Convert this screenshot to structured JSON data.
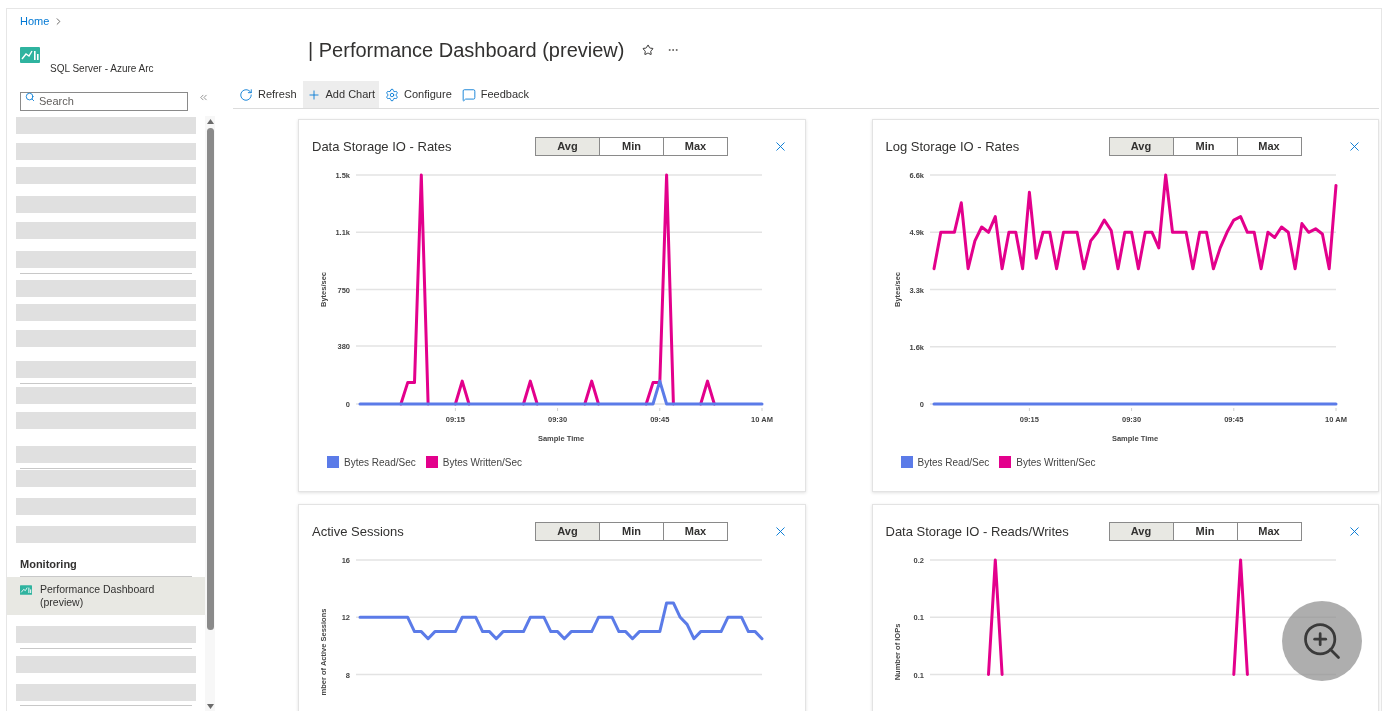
{
  "breadcrumb": [
    {
      "label": "Home"
    }
  ],
  "sidebar": {
    "resource_type": "SQL Server - Azure Arc",
    "search": {
      "placeholder": "Search"
    },
    "sections": [
      {
        "title": "Monitoring",
        "items": [
          {
            "label": "Performance Dashboard (preview)",
            "selected": true
          }
        ]
      }
    ]
  },
  "title": "| Performance Dashboard (preview)",
  "toolbar": [
    {
      "label": "Refresh",
      "kind": "refresh",
      "highlighted": false
    },
    {
      "label": "Add Chart",
      "kind": "add",
      "highlighted": true
    },
    {
      "label": "Configure",
      "kind": "configure",
      "highlighted": false
    },
    {
      "label": "Feedback",
      "kind": "feedback",
      "highlighted": false
    }
  ],
  "cards": [
    {
      "title": "Data Storage IO - Rates",
      "aggregations": [
        {
          "label": "Avg",
          "selected": true
        },
        {
          "label": "Min",
          "selected": false
        },
        {
          "label": "Max",
          "selected": false
        }
      ],
      "chart_data": {
        "type": "line",
        "xlabel": "Sample Time",
        "ylabel": "Bytes/sec",
        "ylim": [
          0,
          1500
        ],
        "grid": true,
        "categories": [
          null,
          null,
          null,
          null,
          null,
          null,
          null,
          null,
          null,
          null,
          null,
          null,
          null,
          null,
          "09:15",
          null,
          null,
          null,
          null,
          null,
          null,
          null,
          null,
          null,
          null,
          null,
          null,
          null,
          null,
          "09:30",
          null,
          null,
          null,
          null,
          null,
          null,
          null,
          null,
          null,
          null,
          null,
          null,
          null,
          null,
          "09:45",
          null,
          null,
          null,
          null,
          null,
          null,
          null,
          null,
          null,
          null,
          null,
          null,
          null,
          null,
          "10 AM"
        ],
        "yticks": [
          0,
          380,
          750,
          {
            "value": 1125,
            "label": "1.1k"
          },
          {
            "value": 1500,
            "label": "1.5k"
          }
        ],
        "series": [
          {
            "name": "Bytes Read/Sec",
            "color": "#5b7be8",
            "values": [
              0,
              0,
              0,
              0,
              0,
              0,
              0,
              0,
              0,
              0,
              0,
              0,
              0,
              0,
              0,
              0,
              0,
              0,
              0,
              0,
              0,
              0,
              0,
              0,
              0,
              0,
              0,
              0,
              0,
              0,
              0,
              0,
              0,
              0,
              0,
              0,
              0,
              0,
              0,
              0,
              0,
              0,
              0,
              0,
              150,
              0,
              0,
              0,
              0,
              0,
              0,
              0,
              0,
              0,
              0,
              0,
              0,
              0,
              0,
              0
            ]
          },
          {
            "name": "Bytes Written/Sec",
            "color": "#e3008c",
            "values": [
              null,
              null,
              null,
              null,
              null,
              null,
              0,
              140,
              140,
              1500,
              0,
              null,
              null,
              null,
              0,
              150,
              0,
              null,
              null,
              null,
              null,
              null,
              null,
              null,
              0,
              150,
              0,
              null,
              null,
              null,
              null,
              null,
              null,
              0,
              150,
              0,
              null,
              null,
              null,
              null,
              null,
              null,
              0,
              140,
              140,
              1500,
              0,
              null,
              null,
              null,
              0,
              150,
              0,
              null,
              null,
              null,
              null,
              null,
              null,
              null
            ]
          }
        ]
      }
    },
    {
      "title": "Log Storage IO - Rates",
      "aggregations": [
        {
          "label": "Avg",
          "selected": true
        },
        {
          "label": "Min",
          "selected": false
        },
        {
          "label": "Max",
          "selected": false
        }
      ],
      "chart_data": {
        "type": "line",
        "xlabel": "Sample Time",
        "ylabel": "Bytes/sec",
        "ylim": [
          0,
          6600
        ],
        "grid": true,
        "categories": [
          null,
          null,
          null,
          null,
          null,
          null,
          null,
          null,
          null,
          null,
          null,
          null,
          null,
          null,
          "09:15",
          null,
          null,
          null,
          null,
          null,
          null,
          null,
          null,
          null,
          null,
          null,
          null,
          null,
          null,
          "09:30",
          null,
          null,
          null,
          null,
          null,
          null,
          null,
          null,
          null,
          null,
          null,
          null,
          null,
          null,
          "09:45",
          null,
          null,
          null,
          null,
          null,
          null,
          null,
          null,
          null,
          null,
          null,
          null,
          null,
          null,
          "10 AM"
        ],
        "yticks": [
          0,
          {
            "value": 1650,
            "label": "1.6k"
          },
          {
            "value": 3300,
            "label": "3.3k"
          },
          {
            "value": 4950,
            "label": "4.9k"
          },
          {
            "value": 6600,
            "label": "6.6k"
          }
        ],
        "series": [
          {
            "name": "Bytes Read/Sec",
            "color": "#5b7be8",
            "values": [
              0,
              0,
              0,
              0,
              0,
              0,
              0,
              0,
              0,
              0,
              0,
              0,
              0,
              0,
              0,
              0,
              0,
              0,
              0,
              0,
              0,
              0,
              0,
              0,
              0,
              0,
              0,
              0,
              0,
              0,
              0,
              0,
              0,
              0,
              0,
              0,
              0,
              0,
              0,
              0,
              0,
              0,
              0,
              0,
              0,
              0,
              0,
              0,
              0,
              0,
              0,
              0,
              0,
              0,
              0,
              0,
              0,
              0,
              0,
              0
            ]
          },
          {
            "name": "Bytes Written/Sec",
            "color": "#e3008c",
            "values": [
              3900,
              4950,
              4950,
              4950,
              5800,
              3900,
              4700,
              5100,
              4950,
              5400,
              3900,
              4950,
              4950,
              3900,
              6100,
              4200,
              4950,
              4950,
              3900,
              4950,
              4950,
              4950,
              3900,
              4700,
              4950,
              5300,
              5000,
              3900,
              4950,
              4950,
              3900,
              4950,
              4950,
              4500,
              6600,
              4950,
              4950,
              4950,
              3900,
              4950,
              4950,
              3900,
              4500,
              4950,
              5300,
              5400,
              4950,
              4950,
              3900,
              4950,
              4800,
              5100,
              4950,
              3900,
              5200,
              4950,
              5050,
              4900,
              3900,
              6300
            ]
          }
        ]
      }
    },
    {
      "title": "Active Sessions",
      "aggregations": [
        {
          "label": "Avg",
          "selected": true
        },
        {
          "label": "Min",
          "selected": false
        },
        {
          "label": "Max",
          "selected": false
        }
      ],
      "chart_data": {
        "type": "line",
        "ylabel": "mber of Active Sessions",
        "ylim": [
          8,
          16
        ],
        "grid": true,
        "categories": [
          null,
          null,
          null,
          null,
          null,
          null,
          null,
          null,
          null,
          null,
          null,
          null,
          null,
          null,
          null,
          null,
          null,
          null,
          null,
          null,
          null,
          null,
          null,
          null,
          null,
          null,
          null,
          null,
          null,
          null,
          null,
          null,
          null,
          null,
          null,
          null,
          null,
          null,
          null,
          null,
          null,
          null,
          null,
          null,
          null,
          null,
          null,
          null,
          null,
          null,
          null,
          null,
          null,
          null,
          null,
          null,
          null,
          null,
          null,
          null
        ],
        "yticks": [
          8,
          12,
          16
        ],
        "series": [
          {
            "color": "#5b7be8",
            "values": [
              12,
              12,
              12,
              12,
              12,
              12,
              12,
              12,
              11,
              11,
              10.5,
              11,
              11,
              11,
              11,
              12,
              12,
              12,
              11,
              11,
              10.5,
              11,
              11,
              11,
              11,
              12,
              12,
              12,
              11,
              11,
              10.5,
              11,
              11,
              11,
              11,
              12,
              12,
              12,
              11,
              11,
              10.5,
              11,
              11,
              11,
              11,
              13,
              13,
              12,
              11.5,
              10.5,
              11,
              11,
              11,
              11,
              12,
              12,
              12,
              11,
              11,
              10.5
            ]
          }
        ]
      }
    },
    {
      "title": "Data Storage IO - Reads/Writes",
      "aggregations": [
        {
          "label": "Avg",
          "selected": true
        },
        {
          "label": "Min",
          "selected": false
        },
        {
          "label": "Max",
          "selected": false
        }
      ],
      "chart_data": {
        "type": "line",
        "ylabel": "Number of IOPs",
        "ylim": [
          0.1,
          0.2
        ],
        "grid": true,
        "categories": [
          null,
          null,
          null,
          null,
          null,
          null,
          null,
          null,
          null,
          null,
          null,
          null,
          null,
          null,
          null,
          null,
          null,
          null,
          null,
          null,
          null,
          null,
          null,
          null,
          null,
          null,
          null,
          null,
          null,
          null,
          null,
          null,
          null,
          null,
          null,
          null,
          null,
          null,
          null,
          null,
          null,
          null,
          null,
          null,
          null,
          null,
          null,
          null,
          null,
          null,
          null,
          null,
          null,
          null,
          null,
          null,
          null,
          null,
          null,
          null
        ],
        "yticks": [
          {
            "value": 0.1,
            "label": "0.1"
          },
          {
            "value": 0.15,
            "label": "0.1"
          },
          {
            "value": 0.2,
            "label": "0.2"
          }
        ],
        "series": [
          {
            "color": "#e3008c",
            "values": [
              null,
              null,
              null,
              null,
              null,
              null,
              null,
              null,
              0.1,
              0.2,
              0.1,
              null,
              null,
              null,
              null,
              null,
              null,
              null,
              null,
              null,
              null,
              null,
              null,
              null,
              null,
              null,
              null,
              null,
              null,
              null,
              null,
              null,
              null,
              null,
              null,
              null,
              null,
              null,
              null,
              null,
              null,
              null,
              null,
              null,
              0.1,
              0.2,
              0.1,
              null,
              null,
              null,
              null,
              null,
              null,
              null,
              null,
              null,
              null,
              null,
              null,
              null
            ]
          }
        ]
      }
    }
  ]
}
